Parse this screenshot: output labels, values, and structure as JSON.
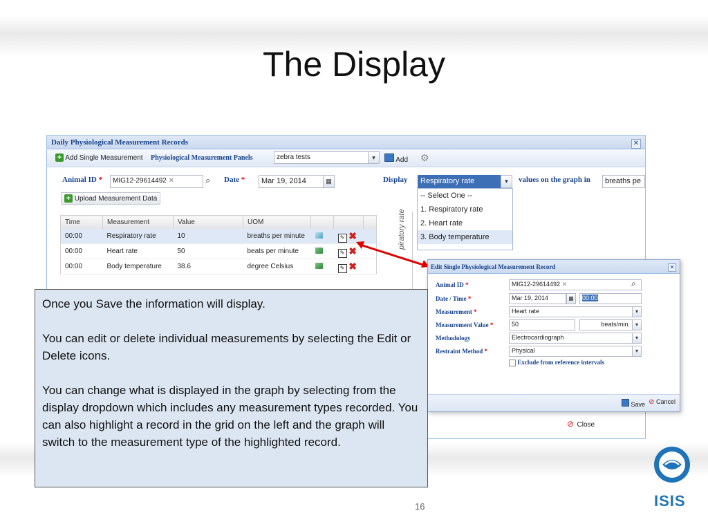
{
  "slide": {
    "title": "The Display",
    "number": "16",
    "logo_text": "ISIS"
  },
  "window": {
    "title": "Daily Physiological Measurement Records",
    "toolbar": {
      "add_single": "Add Single Measurement",
      "panels_label": "Physiological Measurement Panels",
      "panels_value": "zebra tests",
      "add": "Add"
    },
    "animal_id_label": "Animal ID",
    "animal_id_value": "MIG12-29614492",
    "date_label": "Date",
    "date_value": "Mar 19, 2014",
    "display_label": "Display",
    "display_value": "Respiratory rate",
    "values_label": "values on the graph in",
    "values_unit": "breaths pe",
    "upload_button": "Upload Measurement Data",
    "grid": {
      "headers": [
        "Time",
        "Measurement",
        "Value",
        "UOM"
      ],
      "rows": [
        [
          "00:00",
          "Respiratory rate",
          "10",
          "breaths per minute"
        ],
        [
          "00:00",
          "Heart rate",
          "50",
          "beats per minute"
        ],
        [
          "00:00",
          "Body temperature",
          "38.6",
          "degree Celsius"
        ]
      ]
    },
    "dropdown_options": [
      "-- Select One --",
      "1. Respiratory rate",
      "2. Heart rate",
      "3. Body temperature"
    ],
    "chart_axis_label": "piratory rate",
    "close_button": "Close"
  },
  "dialog": {
    "title": "Edit Single Physiological Measurement Record",
    "animal_id_label": "Animal ID",
    "animal_id_value": "MIG12-29614492",
    "datetime_label": "Date / Time",
    "date_value": "Mar 19, 2014",
    "time_value": "00:00",
    "measurement_label": "Measurement",
    "measurement_value": "Heart rate",
    "measurement_value_label": "Measurement Value",
    "value": "50",
    "value_unit": "beats/min.",
    "methodology_label": "Methodology",
    "methodology_value": "Electrocardiograph",
    "restraint_label": "Restraint Method",
    "restraint_value": "Physical",
    "exclude_label": "Exclude from reference intervals",
    "save": "Save",
    "cancel": "Cancel"
  },
  "callout": {
    "p1": "Once you Save the information will display.",
    "p2": "You can edit or delete individual measurements by selecting the Edit or Delete icons.",
    "p3": "You can change what is displayed in the graph by selecting from the display dropdown which includes any measurement types recorded. You can also highlight a record in the grid on the left and the graph will switch to the measurement type of the highlighted record."
  },
  "colors": {
    "accent": "#15428b",
    "arrow": "#e00000",
    "callout_bg": "#dce6f2"
  }
}
